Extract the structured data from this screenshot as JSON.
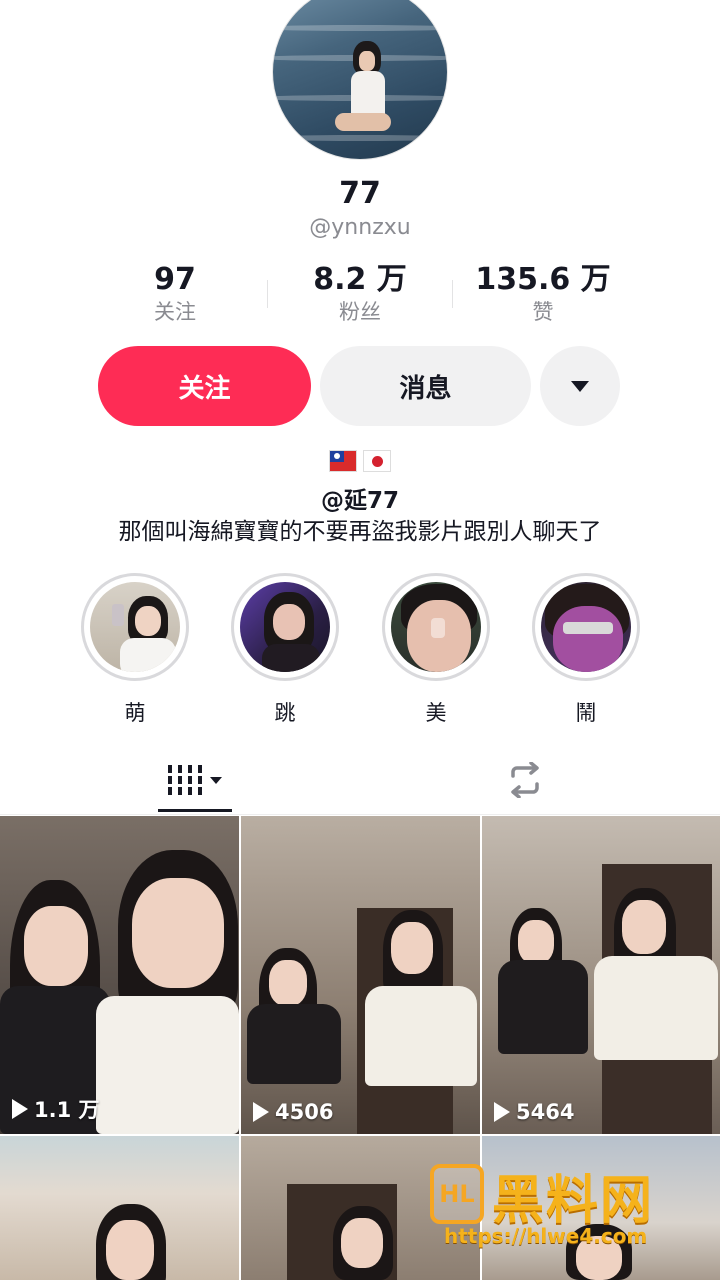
{
  "profile": {
    "nickname": "77",
    "handle": "@ynnzxu",
    "avatar_icon": "profile-avatar"
  },
  "stats": [
    {
      "value": "97",
      "label": "关注"
    },
    {
      "value": "8.2 万",
      "label": "粉丝"
    },
    {
      "value": "135.6 万",
      "label": "赞"
    }
  ],
  "actions": {
    "follow_label": "关注",
    "message_label": "消息",
    "more_icon": "caret-down-icon"
  },
  "bio": {
    "flags": [
      "taiwan-flag",
      "japan-flag"
    ],
    "handle": "@延77",
    "text": "那個叫海綿寶寶的不要再盜我影片跟別人聊天了"
  },
  "highlights": [
    {
      "label": "萌"
    },
    {
      "label": "跳"
    },
    {
      "label": "美"
    },
    {
      "label": "鬧"
    }
  ],
  "tabs": {
    "videos_icon": "grid-bars-icon",
    "reposts_icon": "repost-icon"
  },
  "videos": [
    {
      "views": "1.1 万"
    },
    {
      "views": "4506"
    },
    {
      "views": "5464"
    },
    {
      "views": ""
    },
    {
      "views": ""
    },
    {
      "views": ""
    }
  ],
  "watermark": {
    "title": "黑料网",
    "url": "https://hlwe4.com",
    "logo_text": "HL"
  },
  "colors": {
    "accent": "#fe2c55",
    "secondary_button": "#f1f1f2",
    "muted_text": "#8a8b91"
  }
}
